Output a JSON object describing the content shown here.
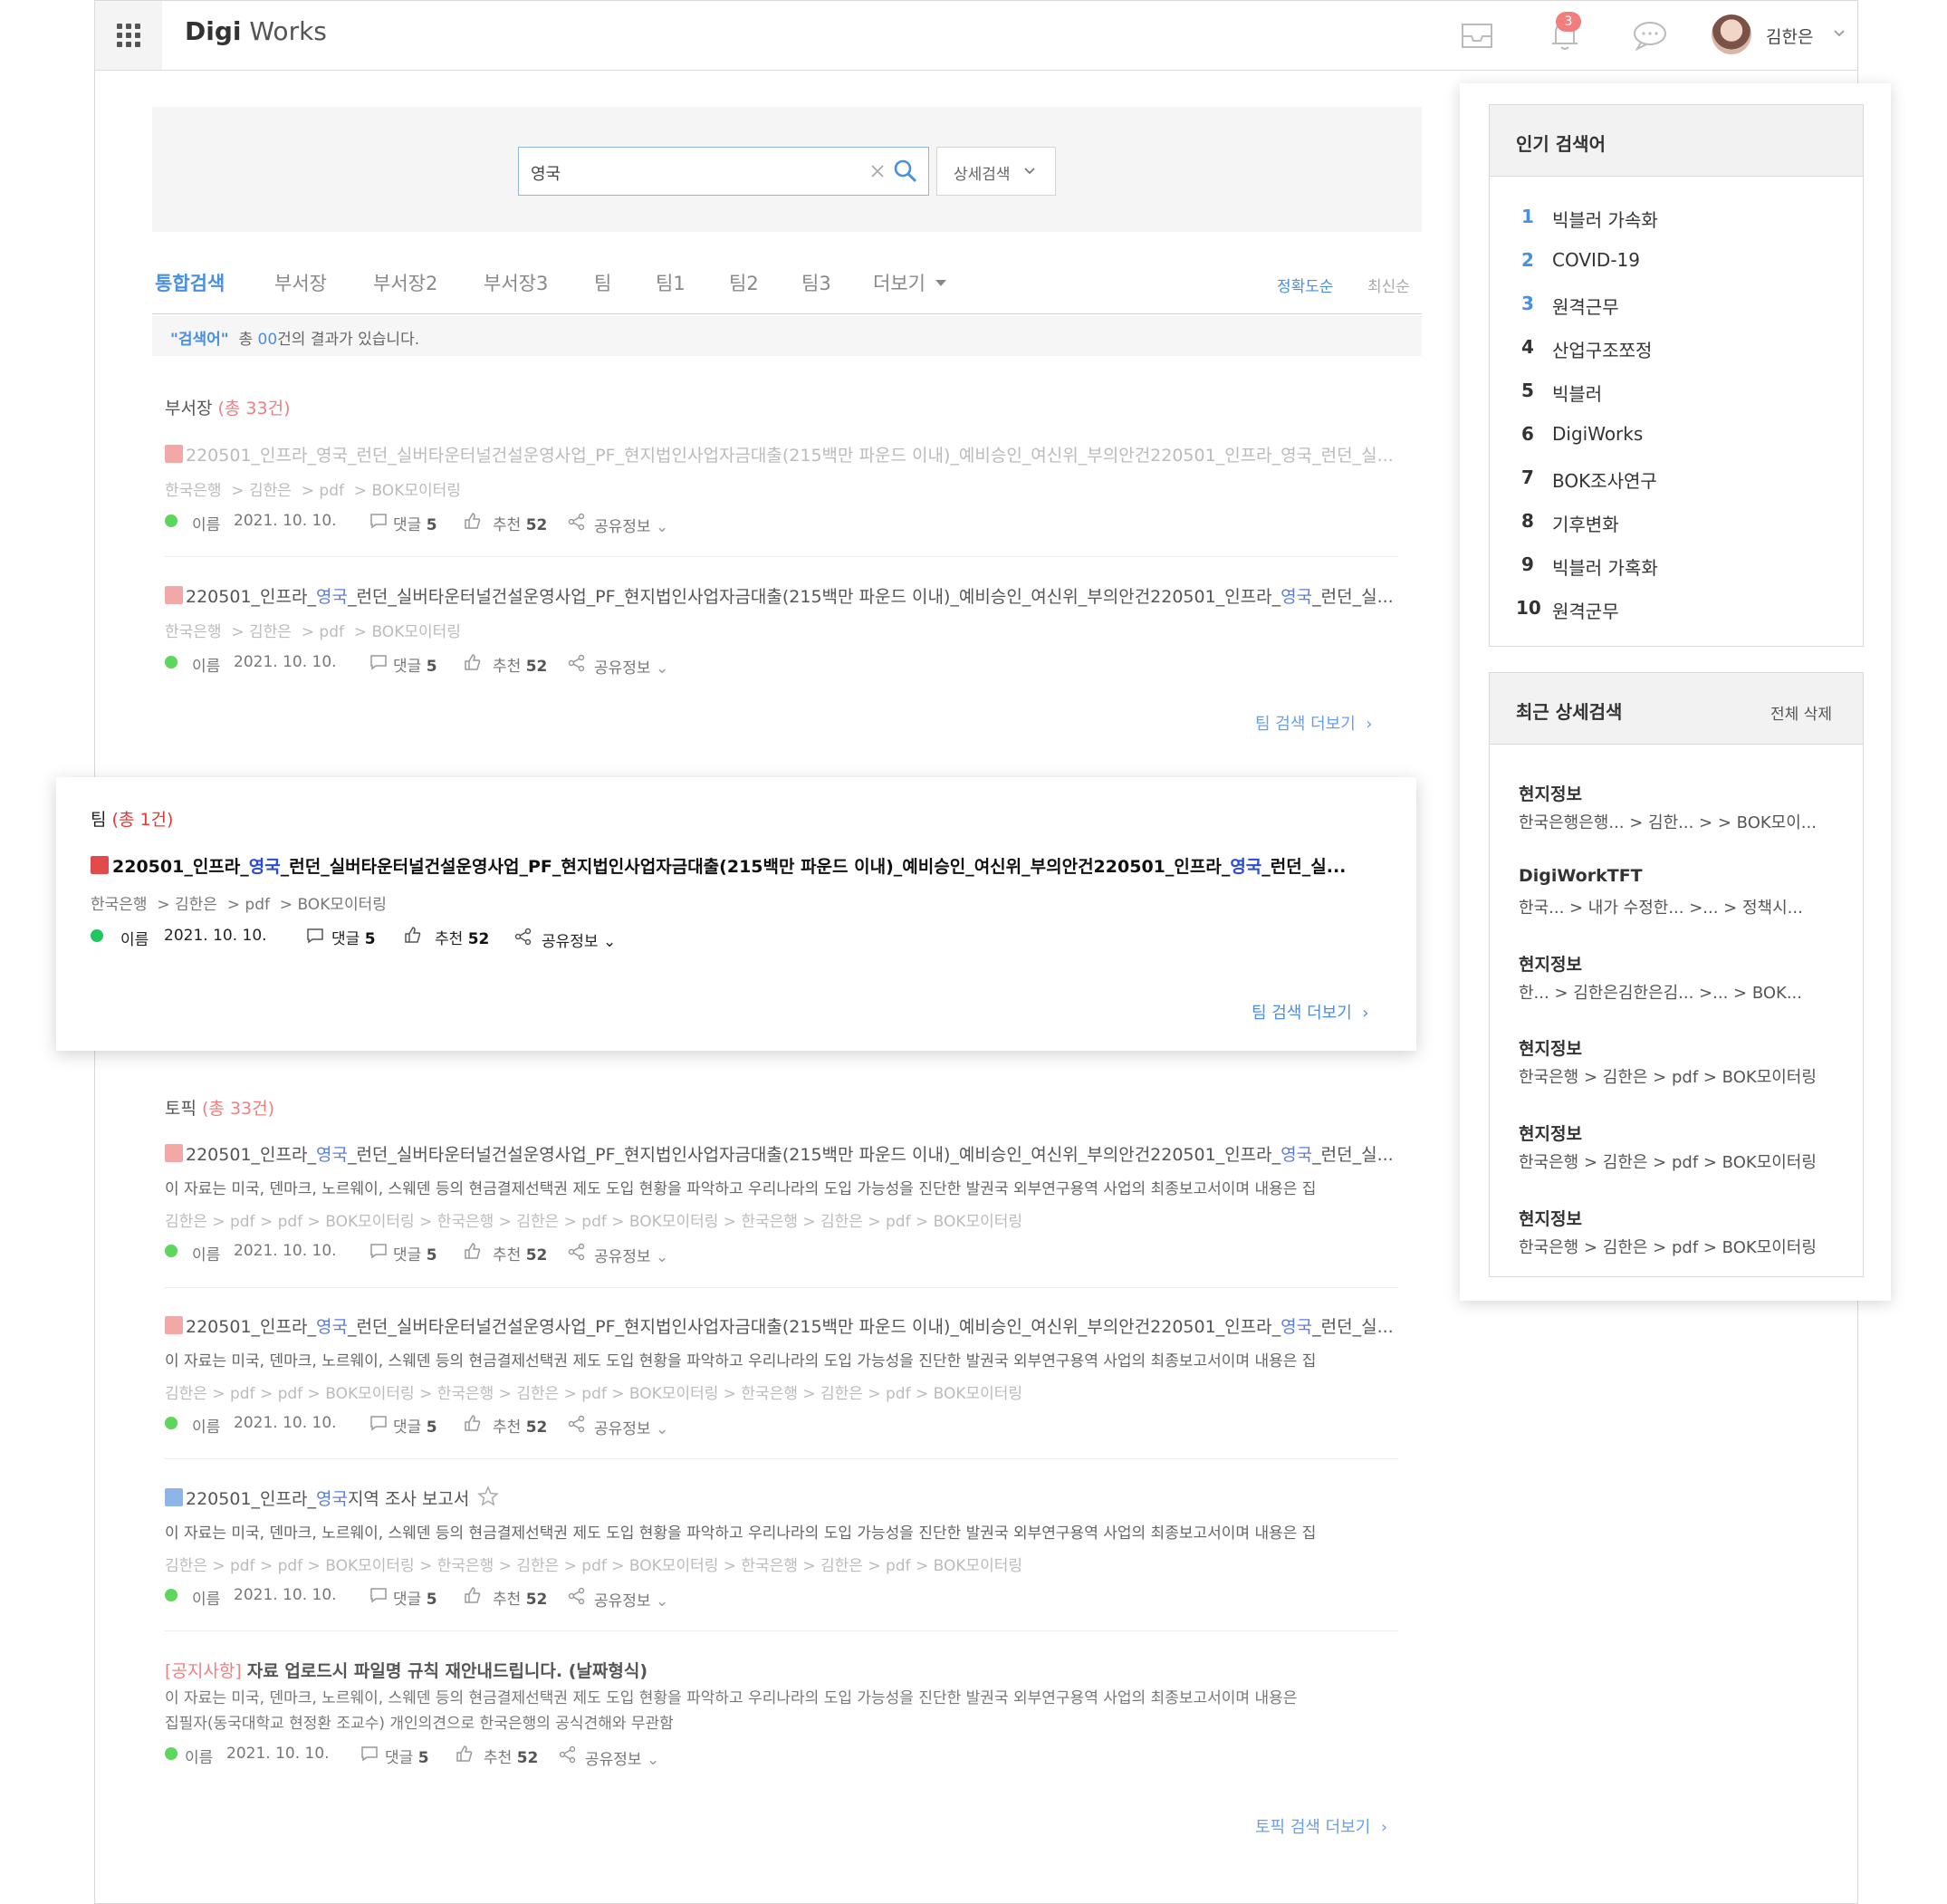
{
  "header": {
    "logo_bold": "Digi",
    "logo_light": "Works",
    "notification_count": "3",
    "user_name": "김한은"
  },
  "search": {
    "query": "영국",
    "advanced_label": "상세검색"
  },
  "tabs": [
    "통합검색",
    "부서장",
    "부서장2",
    "부서장3",
    "팀",
    "팀1",
    "팀2",
    "팀3",
    "더보기"
  ],
  "sort": {
    "accuracy": "정확도순",
    "latest": "최신순"
  },
  "result_summary": {
    "keyword": "\"검색어\"",
    "pre": "총",
    "count": "00",
    "post": "건의 결과가 있습니다."
  },
  "meta_labels": {
    "name": "이름",
    "date": "2021. 10. 10.",
    "comment": "댓글",
    "comment_count": "5",
    "like": "추천",
    "like_count": "52",
    "share": "공유정보"
  },
  "doc_title": {
    "part1": "220501_인프라_",
    "hl": "영국",
    "part2": "_런던_실버타운터널건설운영사업_PF_현지법인사업자금대출(215백만 파운드 이내)_예비승인_여신위_부의안건220501_인프라_",
    "part3": "_런던_실..."
  },
  "description": "이 자료는 미국, 덴마크, 노르웨이, 스웨덴 등의 현금결제선택권 제도 도입 현황을 파악하고 우리나라의 도입 가능성을 진단한 발권국 외부연구용역 사업의 최종보고서이며 내용은 집",
  "sections": {
    "dept": {
      "label": "부서장",
      "count": "(총 33건)",
      "paths": [
        "한국은행",
        "> 김한은",
        "> pdf",
        "> BOK모이터링"
      ],
      "more": "팀 검색 더보기"
    },
    "team": {
      "label": "팀",
      "count": "(총 1건)",
      "more": "팀 검색 더보기"
    },
    "topic": {
      "label": "토픽",
      "count": "(총 33건)",
      "long_path": "김한은 > pdf > pdf > BOK모이터링 > 한국은행 > 김한은 > pdf > BOK모이터링 > 한국은행 > 김한은 > pdf > BOK모이터링",
      "report_title_pre": "220501_인프라_",
      "report_title_post": "지역 조사 보고서",
      "notice_tag": "[공지사항]",
      "notice_title": "자료 업로드시 파일명 규칙 재안내드립니다. (날짜형식)",
      "notice_desc_1": "이 자료는 미국, 덴마크, 노르웨이, 스웨덴 등의 현금결제선택권 제도 도입 현황을 파악하고 우리나라의 도입 가능성을 진단한 발권국 외부연구용역 사업의 최종보고서이며 내용은",
      "notice_desc_2": "집필자(동국대학교 현정환 조교수) 개인의견으로 한국은행의 공식견해와 무관함",
      "more": "토픽 검색 더보기"
    }
  },
  "popular": {
    "title": "인기 검색어",
    "items": [
      {
        "rank": "1",
        "word": "빅블러 가속화"
      },
      {
        "rank": "2",
        "word": "COVID-19"
      },
      {
        "rank": "3",
        "word": "원격근무"
      },
      {
        "rank": "4",
        "word": "산업구조쪼정"
      },
      {
        "rank": "5",
        "word": "빅블러"
      },
      {
        "rank": "6",
        "word": "DigiWorks"
      },
      {
        "rank": "7",
        "word": "BOK조사연구"
      },
      {
        "rank": "8",
        "word": "기후변화"
      },
      {
        "rank": "9",
        "word": "빅블러 가혹화"
      },
      {
        "rank": "10",
        "word": "원격군무"
      }
    ]
  },
  "recent": {
    "title": "최근 상세검색",
    "clear_all": "전체 삭제",
    "items": [
      {
        "title": "현지정보",
        "path": "한국은행은행... > 김한...   > > BOK모이..."
      },
      {
        "title": "DigiWorkTFT",
        "path": "한국... > 내가 수정한... >...   > 정책시..."
      },
      {
        "title": "현지정보",
        "path": "한...   > 김한은김한은김...   >... > BOK..."
      },
      {
        "title": "현지정보",
        "path": "한국은행 > 김한은 > pdf > BOK모이터링"
      },
      {
        "title": "현지정보",
        "path": "한국은행 > 김한은 > pdf > BOK모이터링"
      },
      {
        "title": "현지정보",
        "path": "한국은행 > 김한은 > pdf > BOK모이터링"
      }
    ]
  }
}
